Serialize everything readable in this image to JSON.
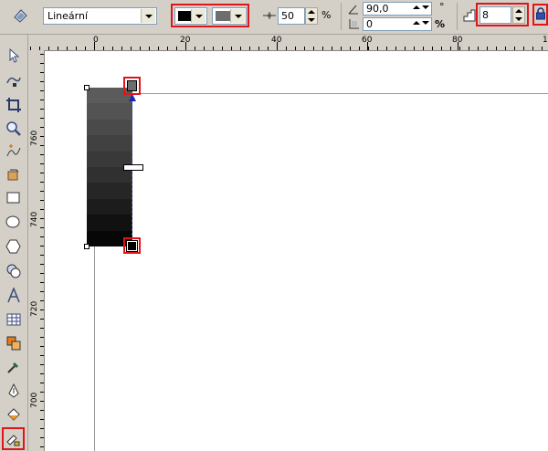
{
  "propbar": {
    "fill_type": "Lineární",
    "from_color": "#000000",
    "to_color": "#6e6e6e",
    "midpoint_value": "50",
    "midpoint_unit": "%",
    "angle_value": "90,0",
    "angle_unit": "°",
    "edge_pad_value": "0",
    "edge_pad_unit": "%",
    "steps_value": "8"
  },
  "toolbox": {
    "tools": [
      "pick-tool-icon",
      "shape-tool-icon",
      "crop-tool-icon",
      "zoom-tool-icon",
      "freehand-tool-icon",
      "smart-fill-tool-icon",
      "rectangle-tool-icon",
      "ellipse-tool-icon",
      "polygon-tool-icon",
      "basic-shapes-tool-icon",
      "text-tool-icon",
      "table-tool-icon",
      "interactive-tool-icon",
      "eyedropper-tool-icon",
      "outline-tool-icon",
      "fill-tool-icon",
      "interactive-fill-tool-icon"
    ]
  },
  "hruler": {
    "labels": [
      "0",
      "20",
      "40",
      "60",
      "80",
      "1"
    ]
  },
  "vruler": {
    "labels": [
      "760",
      "740",
      "720",
      "700"
    ]
  },
  "gradient": {
    "stops": [
      "#5b5b5b",
      "#535353",
      "#4a4a4a",
      "#414141",
      "#393939",
      "#303030",
      "#262626",
      "#1c1c1c",
      "#111111",
      "#070707"
    ]
  },
  "colors": {
    "highlight": "#e0151b",
    "ui_bg": "#d4d0c8"
  }
}
